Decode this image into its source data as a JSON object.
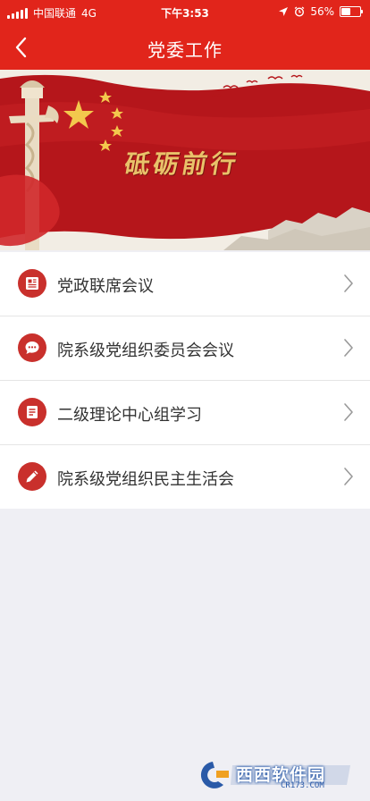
{
  "status_bar": {
    "carrier": "中国联通",
    "network": "4G",
    "time": "下午3:53",
    "battery_percent": "56%",
    "battery_level": 0.56
  },
  "nav": {
    "title": "党委工作",
    "back_icon": "chevron-left-icon"
  },
  "banner": {
    "text": "砥砺前行"
  },
  "menu": {
    "items": [
      {
        "label": "党政联席会议",
        "icon": "document-icon"
      },
      {
        "label": "院系级党组织委员会会议",
        "icon": "chat-bubble-icon"
      },
      {
        "label": "二级理论中心组学习",
        "icon": "notes-icon"
      },
      {
        "label": "院系级党组织民主生活会",
        "icon": "pencil-icon"
      }
    ]
  },
  "watermark": {
    "text": "西西软件园",
    "sub": "CR173.COM"
  },
  "colors": {
    "brand_red": "#e1251b",
    "icon_red": "#c9302c",
    "background": "#efeff4"
  }
}
